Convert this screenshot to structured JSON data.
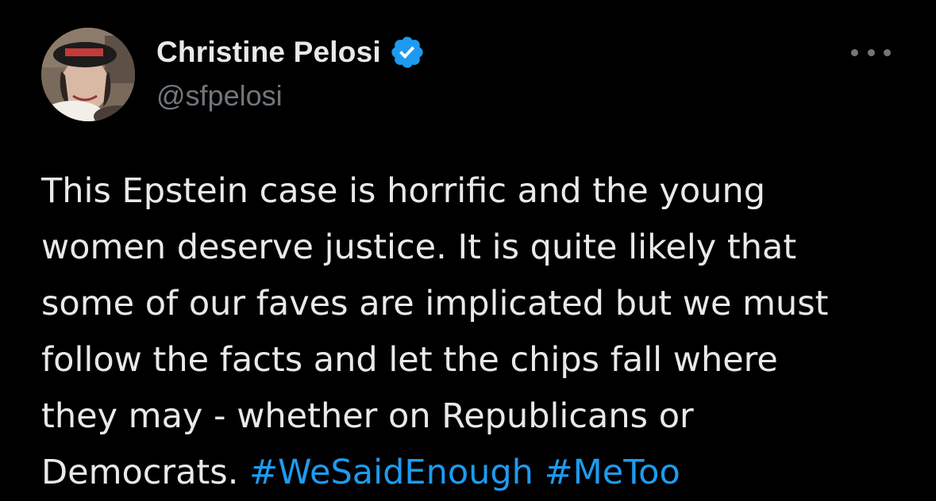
{
  "author": {
    "display_name": "Christine Pelosi",
    "handle": "@sfpelosi",
    "verified_icon": "verified-badge-icon"
  },
  "menu": {
    "icon": "more-horizontal-icon"
  },
  "tweet": {
    "lines": [
      "This Epstein case is horrific and the young",
      "women deserve justice. It is quite likely that",
      "some of our faves are implicated but we must",
      "follow the facts and let the chips fall where",
      "they may - whether on Republicans or"
    ],
    "last_line_text": "Democrats. ",
    "hashtags": [
      "#WeSaidEnough",
      "#MeToo"
    ]
  },
  "colors": {
    "background": "#000000",
    "text": "#e7e9ea",
    "secondary_text": "#71767b",
    "link": "#1d9bf0",
    "verified": "#1d9bf0"
  }
}
